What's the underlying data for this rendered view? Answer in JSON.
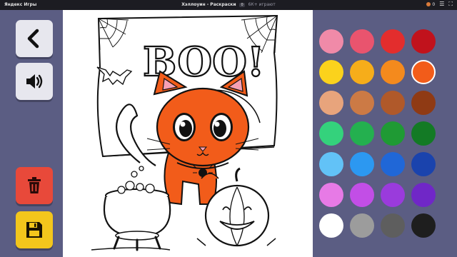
{
  "topbar": {
    "brand": "Яндекс Игры",
    "title": "Хэллоуин - Раскраски",
    "version": "0",
    "players": "6К+ играют",
    "coins": "0"
  },
  "canvas_text": {
    "boo": "BOO!"
  },
  "palette": {
    "selected_index": 7,
    "colors": [
      "#f08aa8",
      "#e9546e",
      "#e32d2d",
      "#c1121c",
      "#fbd21c",
      "#f6ad1a",
      "#f48a1d",
      "#f25c1a",
      "#e8a47c",
      "#cc7a45",
      "#b0592a",
      "#8f3a14",
      "#34d27c",
      "#24b04f",
      "#1f9a34",
      "#137a25",
      "#62c2f7",
      "#2c98f1",
      "#2067d7",
      "#1a43ad",
      "#e77ae6",
      "#c24ee6",
      "#9a3bdc",
      "#7027c7",
      "#ffffff",
      "#9c9c9c",
      "#5e5e5e",
      "#1e1e1e"
    ]
  }
}
